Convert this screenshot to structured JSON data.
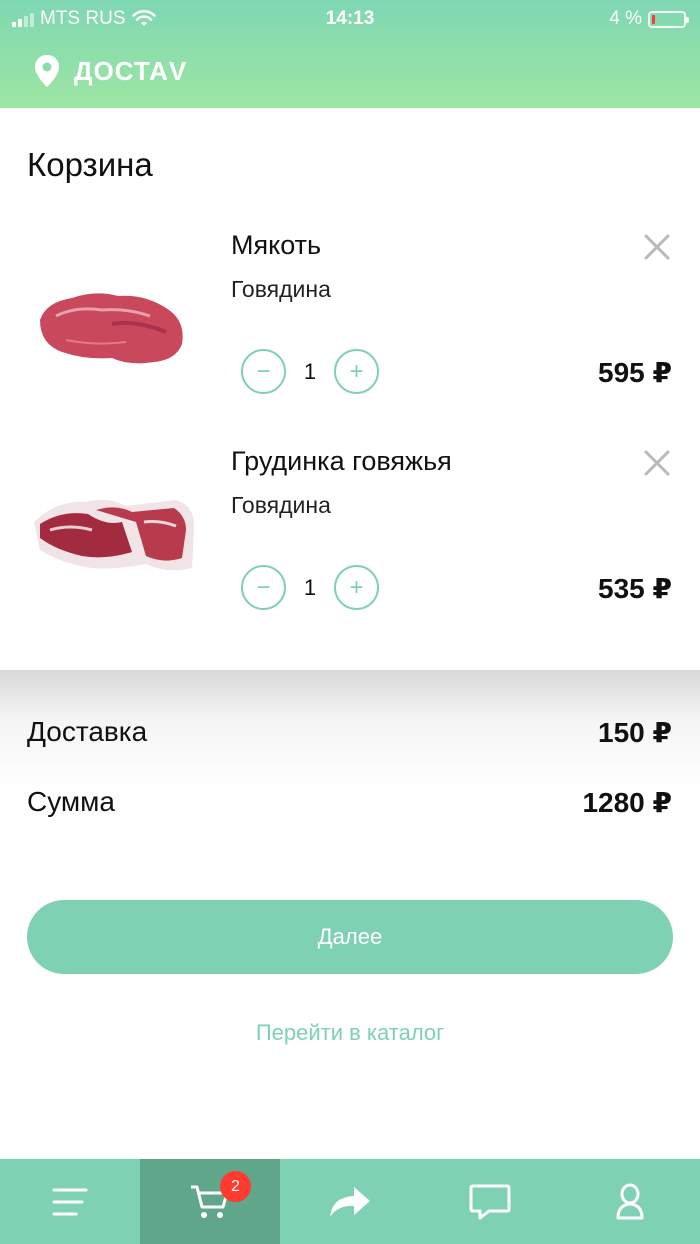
{
  "status_bar": {
    "carrier": "MTS RUS",
    "time": "14:13",
    "battery": "4 %",
    "battery_level": 0.04
  },
  "header": {
    "brand": "ДОСТАV",
    "icon": "location-pin-icon"
  },
  "cart": {
    "title": "Корзина",
    "items": [
      {
        "name": "Мякоть",
        "category": "Говядина",
        "quantity": "1",
        "price": "595 ₽"
      },
      {
        "name": "Грудинка говяжья",
        "category": "Говядина",
        "quantity": "1",
        "price": "535 ₽"
      }
    ]
  },
  "summary": {
    "delivery_label": "Доставка",
    "delivery_value": "150 ₽",
    "total_label": "Сумма",
    "total_value": "1280 ₽"
  },
  "actions": {
    "next_label": "Далее",
    "catalog_link": "Перейти в каталог"
  },
  "tabbar": {
    "cart_badge": "2",
    "icons": [
      "menu-icon",
      "cart-icon",
      "share-icon",
      "chat-icon",
      "profile-icon"
    ]
  },
  "colors": {
    "accent": "#7fd1b3",
    "active_tab": "#5fa68a",
    "badge": "#ff3b30"
  }
}
